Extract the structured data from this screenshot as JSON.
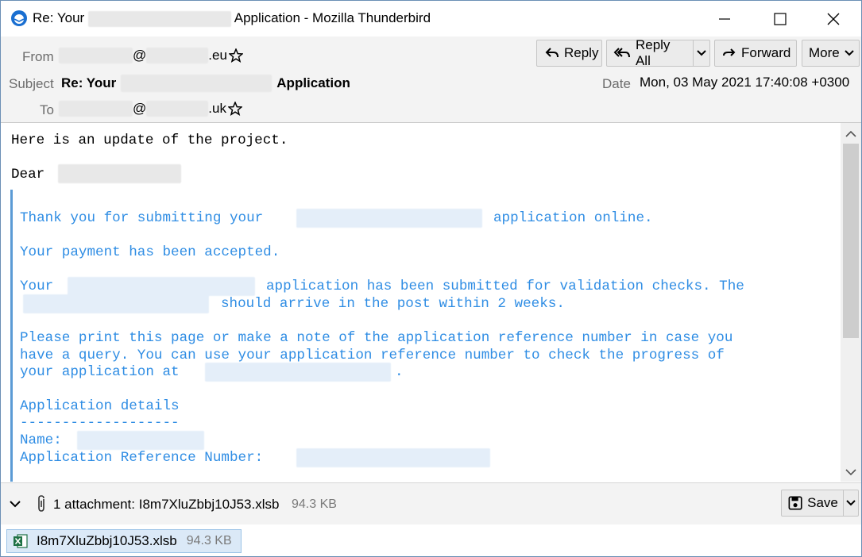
{
  "window": {
    "title_prefix": "Re: Your",
    "title_suffix": "Application - Mozilla Thunderbird",
    "minimize_icon": "minimize-icon",
    "maximize_icon": "maximize-icon",
    "close_icon": "close-icon"
  },
  "header": {
    "from_label": "From",
    "from_at": "@",
    "from_domain": ".eu",
    "subject_label": "Subject",
    "subject_prefix": "Re: Your",
    "subject_suffix": "Application",
    "to_label": "To",
    "to_at": "@",
    "to_domain": ".uk",
    "date_label": "Date",
    "date_value": "Mon, 03 May 2021 17:40:08 +0300",
    "buttons": {
      "reply": "Reply",
      "reply_all": "Reply All",
      "forward": "Forward",
      "more": "More"
    }
  },
  "body": {
    "intro": "Here is an update of the project.",
    "dear": "Dear",
    "q1a": "Thank you for submitting your",
    "q1b": "application online.",
    "q2": "Your payment has been accepted.",
    "q3a": "Your",
    "q3b": "application has been submitted for validation checks. The",
    "q3c": "should arrive in the post within 2 weeks.",
    "q4a": "Please print this page or make a note of the application reference number in case you",
    "q4b": "have a query. You can use your application reference number to check the progress of",
    "q4c": "your application at",
    "q4d": ".",
    "details_title": "Application details",
    "details_rule": "-------------------",
    "name_label": "Name:",
    "ref_label": "Application Reference Number:"
  },
  "attachments": {
    "summary": "1 attachment: I8m7XluZbbj10J53.xlsb",
    "size": "94.3 KB",
    "save_label": "Save",
    "file_name": "I8m7XluZbbj10J53.xlsb",
    "file_size": "94.3 KB"
  }
}
